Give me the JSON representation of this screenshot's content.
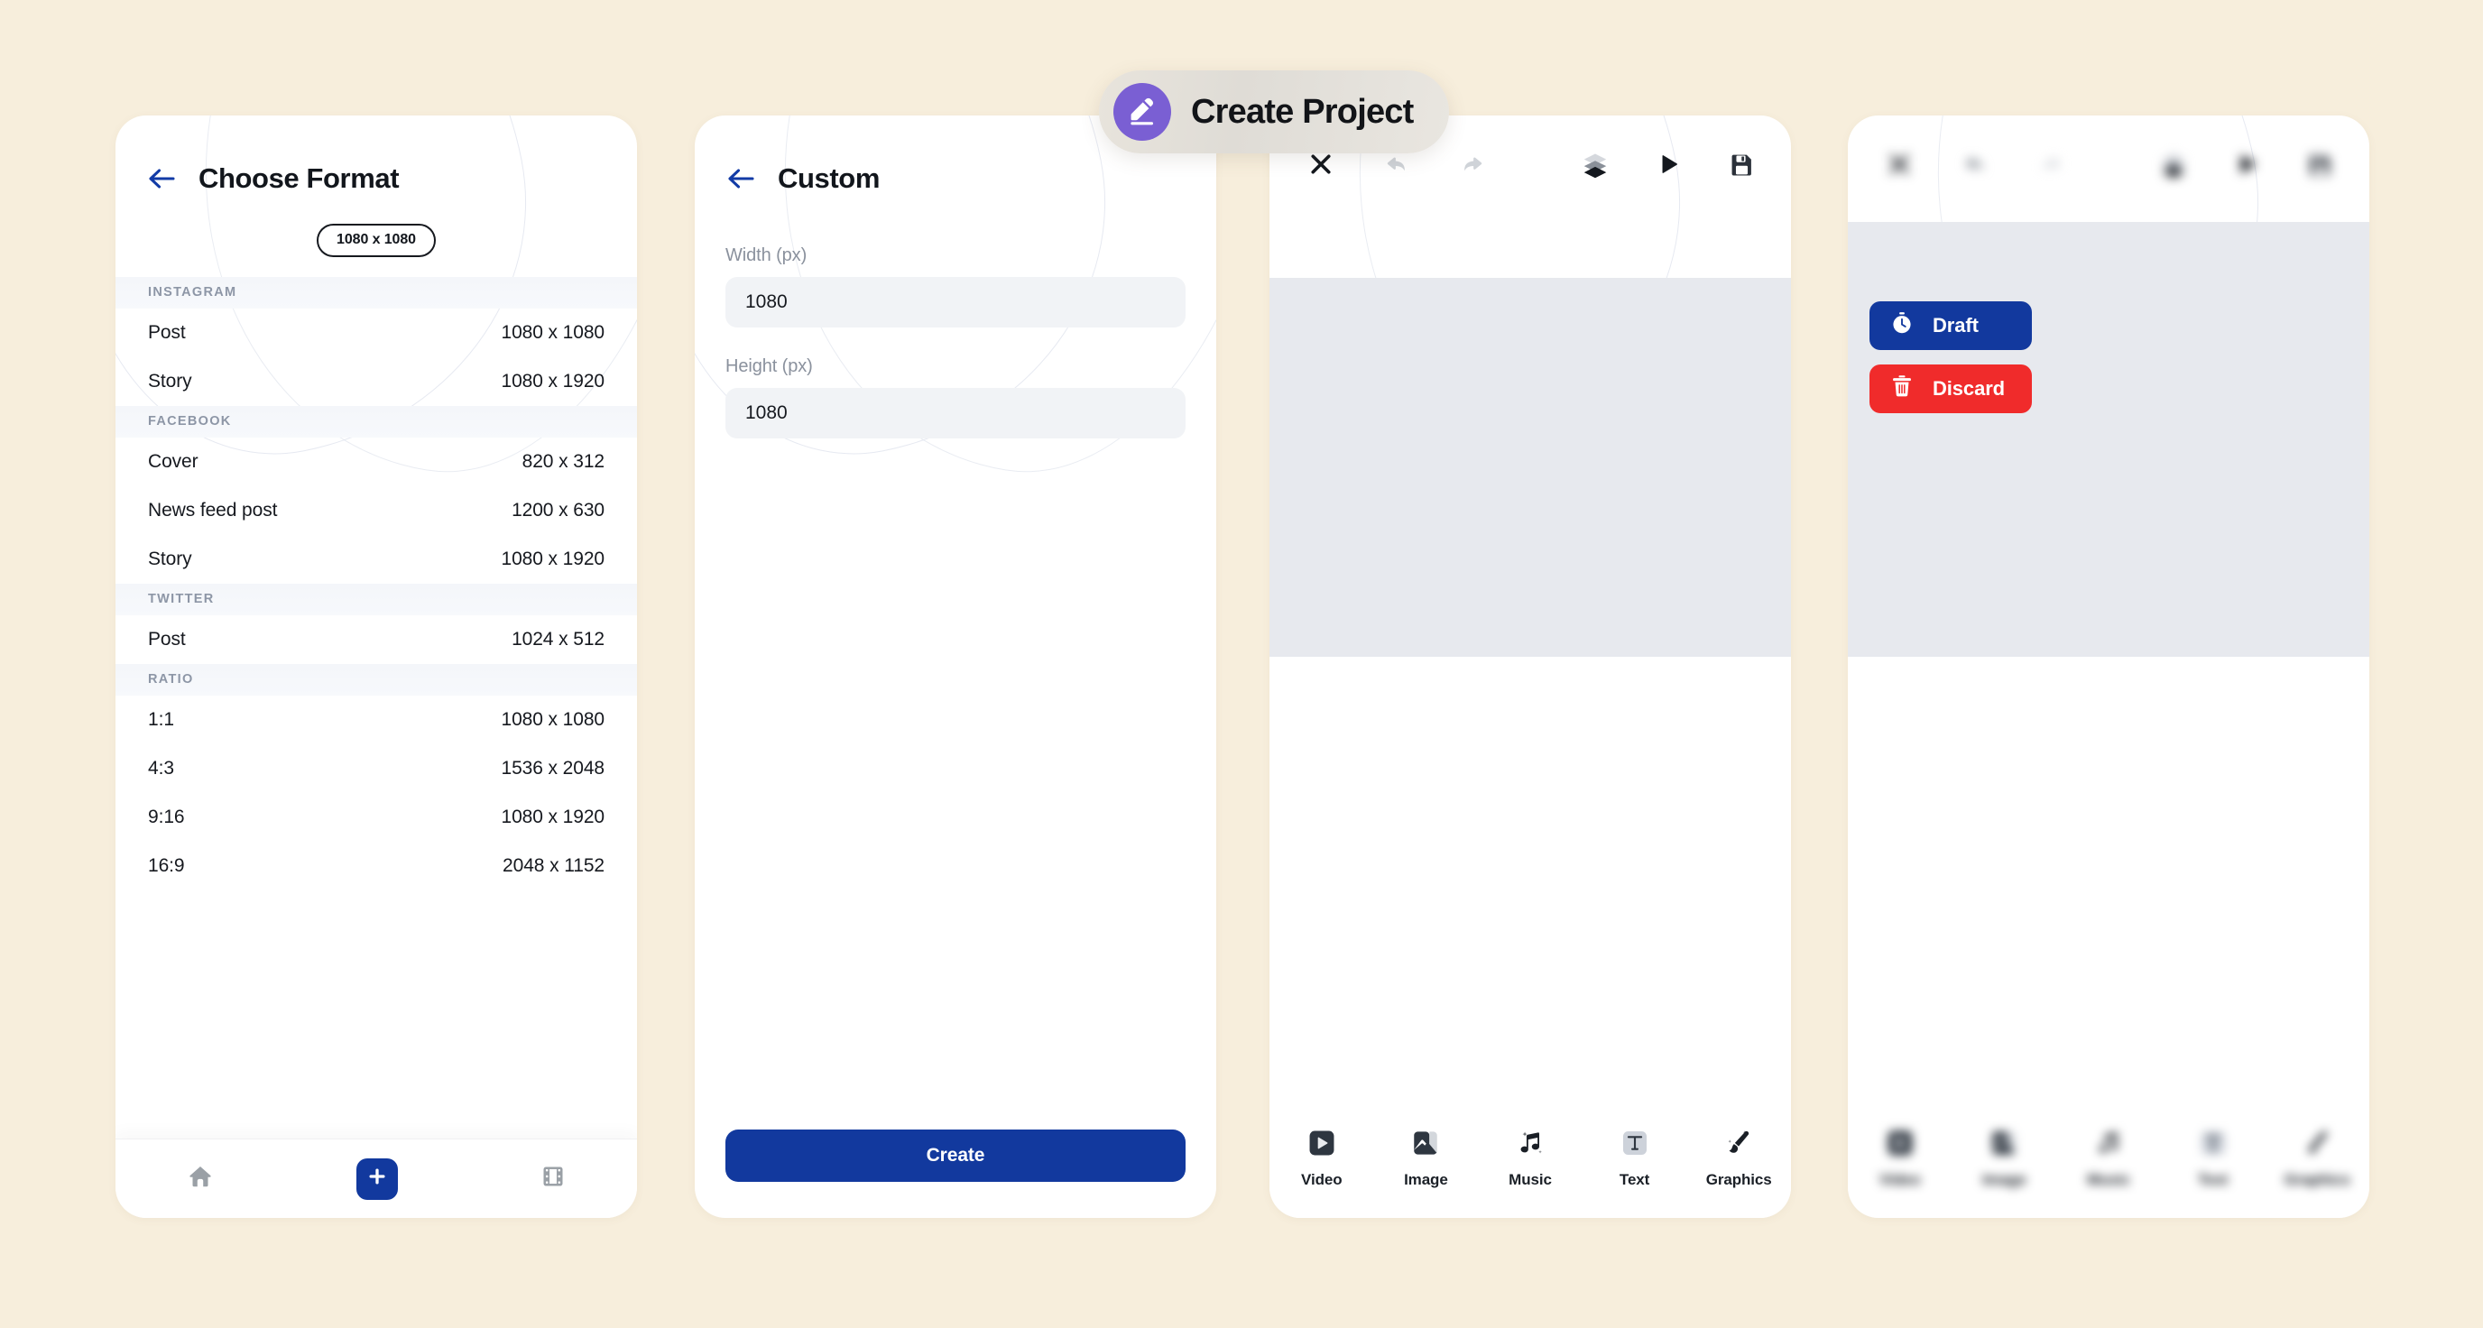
{
  "background_color": "#F7EEDC",
  "accent_blue": "#12399E",
  "danger_red": "#F02B2B",
  "badge_purple": "#7A5FD3",
  "canvas_gray": "#E7E9EE",
  "floating_badge": {
    "label": "Create Project",
    "icon": "pencil-eraser-icon"
  },
  "panel_format": {
    "title": "Choose Format",
    "back_icon": "back-arrow-icon",
    "selected_size_pill": "1080 x 1080",
    "groups": [
      {
        "name": "INSTAGRAM",
        "rows": [
          {
            "label": "Post",
            "value": "1080 x 1080"
          },
          {
            "label": "Story",
            "value": "1080 x 1920"
          }
        ]
      },
      {
        "name": "FACEBOOK",
        "rows": [
          {
            "label": "Cover",
            "value": "820 x 312"
          },
          {
            "label": "News feed post",
            "value": "1200 x 630"
          },
          {
            "label": "Story",
            "value": "1080 x 1920"
          }
        ]
      },
      {
        "name": "TWITTER",
        "rows": [
          {
            "label": "Post",
            "value": "1024 x 512"
          }
        ]
      },
      {
        "name": "RATIO",
        "rows": [
          {
            "label": "1:1",
            "value": "1080 x 1080"
          },
          {
            "label": "4:3",
            "value": "1536 x 2048"
          },
          {
            "label": "9:16",
            "value": "1080 x 1920"
          },
          {
            "label": "16:9",
            "value": "2048 x 1152"
          }
        ]
      }
    ],
    "tabbar": [
      {
        "icon": "home-icon",
        "name": "home"
      },
      {
        "icon": "plus-icon",
        "name": "create"
      },
      {
        "icon": "film-icon",
        "name": "projects"
      }
    ]
  },
  "panel_custom": {
    "title": "Custom",
    "back_icon": "back-arrow-icon",
    "width_label": "Width (px)",
    "width_value": "1080",
    "height_label": "Height (px)",
    "height_value": "1080",
    "create_label": "Create"
  },
  "panel_editor": {
    "toolbar": [
      {
        "icon": "close-icon",
        "name": "close",
        "state": "enabled"
      },
      {
        "icon": "undo-icon",
        "name": "undo",
        "state": "disabled"
      },
      {
        "icon": "redo-icon",
        "name": "redo",
        "state": "disabled"
      },
      {
        "icon": "layers-icon",
        "name": "layers",
        "state": "enabled"
      },
      {
        "icon": "play-icon",
        "name": "preview",
        "state": "enabled"
      },
      {
        "icon": "save-icon",
        "name": "save",
        "state": "enabled"
      }
    ],
    "bottom_tools": [
      {
        "label": "Video",
        "icon": "video-icon"
      },
      {
        "label": "Image",
        "icon": "image-icon"
      },
      {
        "label": "Music",
        "icon": "music-icon"
      },
      {
        "label": "Text",
        "icon": "text-icon"
      },
      {
        "label": "Graphics",
        "icon": "brush-icon"
      }
    ]
  },
  "panel_exit": {
    "draft_label": "Draft",
    "draft_icon": "stopwatch-icon",
    "discard_label": "Discard",
    "discard_icon": "trash-icon",
    "toolbar": [
      {
        "icon": "close-icon",
        "name": "close"
      },
      {
        "icon": "undo-icon",
        "name": "undo"
      },
      {
        "icon": "redo-icon",
        "name": "redo"
      },
      {
        "icon": "layers-icon",
        "name": "layers"
      },
      {
        "icon": "play-icon",
        "name": "preview"
      },
      {
        "icon": "save-icon",
        "name": "save"
      }
    ],
    "bottom_tools": [
      {
        "label": "Video",
        "icon": "video-icon"
      },
      {
        "label": "Image",
        "icon": "image-icon"
      },
      {
        "label": "Music",
        "icon": "music-icon"
      },
      {
        "label": "Text",
        "icon": "text-icon"
      },
      {
        "label": "Graphics",
        "icon": "brush-icon"
      }
    ]
  }
}
